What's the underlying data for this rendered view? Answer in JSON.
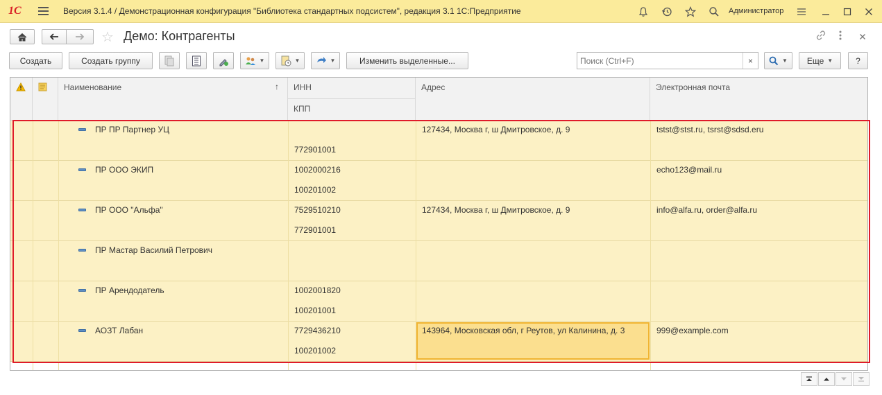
{
  "window": {
    "logo": "1С",
    "title": "Версия 3.1.4 / Демонстрационная конфигурация \"Библиотека стандартных подсистем\", редакция 3.1 1С:Предприятие",
    "user": "Администратор"
  },
  "header": {
    "title": "Демо: Контрагенты"
  },
  "toolbar": {
    "create": "Создать",
    "create_group": "Создать группу",
    "edit_selected": "Изменить выделенные...",
    "search_placeholder": "Поиск (Ctrl+F)",
    "clear": "×",
    "more": "Еще",
    "help": "?"
  },
  "table": {
    "columns": {
      "name": "Наименование",
      "sort_indicator": "↑",
      "inn": "ИНН",
      "kpp": "КПП",
      "address": "Адрес",
      "email": "Электронная почта"
    },
    "rows": [
      {
        "name": "ПР ПР Партнер УЦ",
        "inn": "",
        "kpp": "772901001",
        "address": "127434, Москва г, ш Дмитровское, д. 9",
        "email": "tstst@stst.ru, tsrst@sdsd.eru"
      },
      {
        "name": "ПР ООО ЭКИП",
        "inn": "1002000216",
        "kpp": "100201002",
        "address": "",
        "email": "echo123@mail.ru"
      },
      {
        "name": "ПР ООО \"Альфа\"",
        "inn": "7529510210",
        "kpp": "772901001",
        "address": "127434, Москва г, ш Дмитровское, д. 9",
        "email": "info@alfa.ru, order@alfa.ru"
      },
      {
        "name": "ПР Мастар Василий Петрович",
        "inn": "",
        "kpp": "",
        "address": "",
        "email": ""
      },
      {
        "name": "ПР Арендодатель",
        "inn": "1002001820",
        "kpp": "100201001",
        "address": "",
        "email": ""
      },
      {
        "name": "АОЗТ Лабан",
        "inn": "7729436210",
        "kpp": "100201002",
        "address": "143964, Московская обл, г Реутов, ул Калинина, д. 3",
        "email": "999@example.com"
      }
    ]
  },
  "colors": {
    "titlebar": "#fbeb9b",
    "row_bg": "#fcf1c5",
    "selected_cell": "#fbdf8f",
    "highlight_frame": "#e01b2a"
  }
}
